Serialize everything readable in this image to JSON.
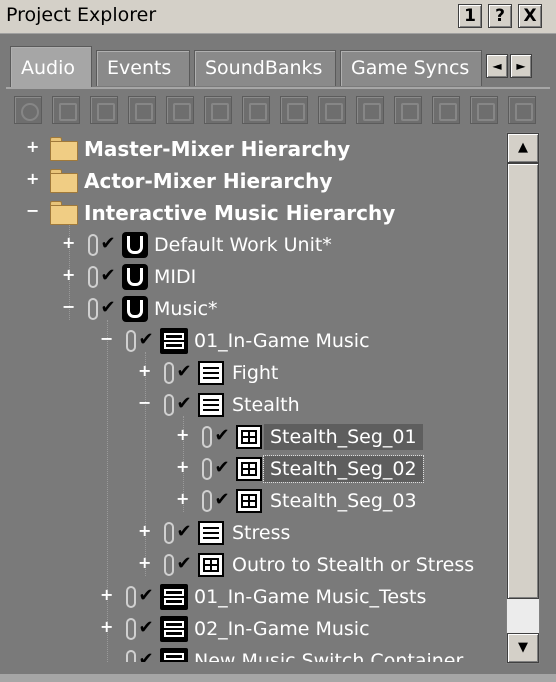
{
  "window": {
    "title": "Project Explorer",
    "buttons": {
      "dock": "1",
      "help": "?",
      "close": "X"
    }
  },
  "tabs": [
    {
      "label": "Audio",
      "active": true
    },
    {
      "label": "Events",
      "active": false
    },
    {
      "label": "SoundBanks",
      "active": false
    },
    {
      "label": "Game Syncs",
      "active": false
    }
  ],
  "tab_scroll": {
    "left": "◄",
    "right": "►"
  },
  "toolbar": {
    "icons": [
      "work-unit-icon",
      "folder-icon",
      "folder-icon",
      "mixer-icon",
      "grid-icon",
      "list-icon",
      "bus-icon",
      "cross-icon",
      "wrench-icon",
      "effects-icon",
      "list2-icon",
      "hand-icon",
      "blend-icon",
      "event-icon"
    ]
  },
  "tree": {
    "hierarchies": {
      "master": "Master-Mixer Hierarchy",
      "actor": "Actor-Mixer Hierarchy",
      "interactive": "Interactive Music Hierarchy"
    },
    "work_units": {
      "default": "Default Work Unit*",
      "midi": "MIDI",
      "music": "Music*"
    },
    "items": {
      "ingame": "01_In-Game Music",
      "fight": "Fight",
      "stealth": "Stealth",
      "seg1": "Stealth_Seg_01",
      "seg2": "Stealth_Seg_02",
      "seg3": "Stealth_Seg_03",
      "stress": "Stress",
      "outro": "Outro to Stealth or Stress",
      "tests": "01_In-Game Music_Tests",
      "ingame2": "02_In-Game Music",
      "newswitch": "New Music Switch Container"
    },
    "expand": "+",
    "collapse": "−",
    "check": "✔"
  },
  "scrollbar": {
    "up": "▲",
    "down": "▼"
  },
  "colors": {
    "background": "#7a7a7a",
    "selection": "#5e5e5e",
    "text": "#ffffff",
    "chrome": "#d4d0c8"
  }
}
